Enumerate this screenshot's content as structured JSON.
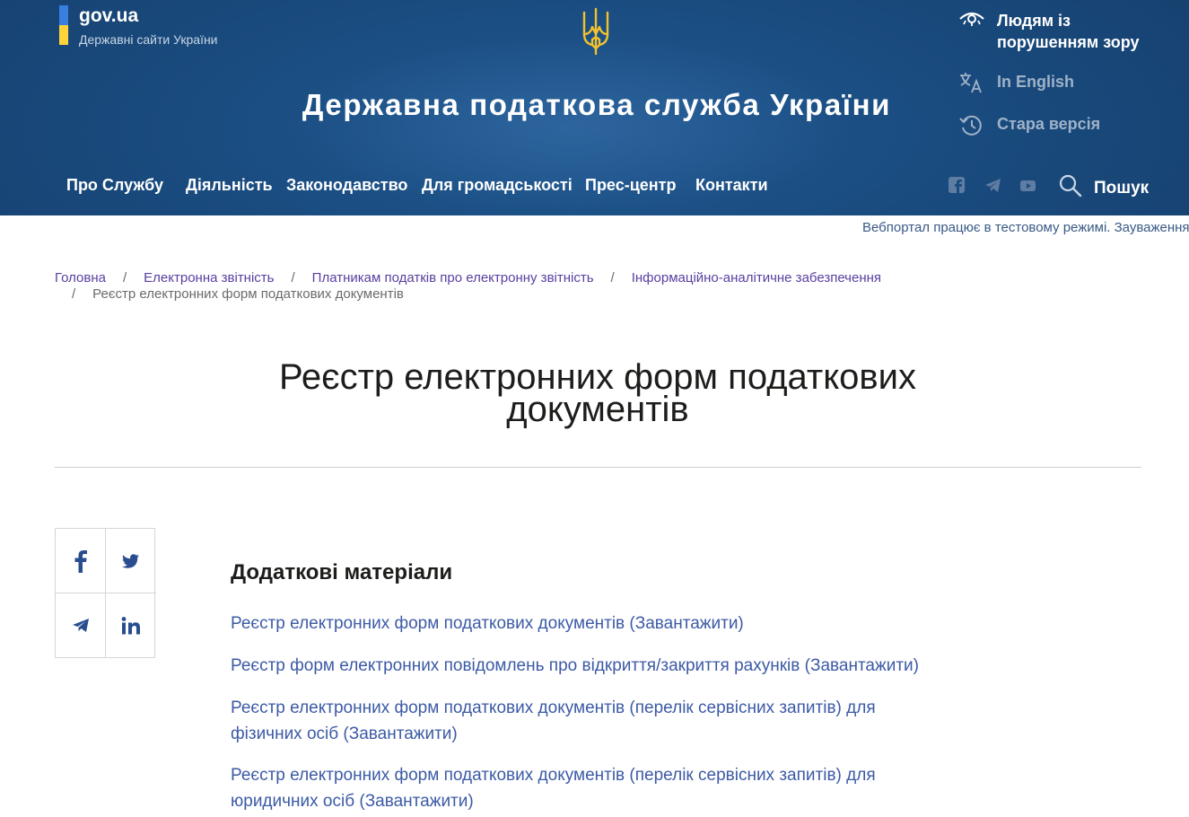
{
  "colors": {
    "header_bg": "#1a4c80",
    "flag_blue": "#3a7ee0",
    "flag_yellow": "#ffd43a",
    "trident": "#f2c12e",
    "link_blue": "#3c5aa5",
    "breadcrumb_link": "#5a3fa0"
  },
  "govua": {
    "name": "gov.ua",
    "subtitle": "Державні сайти України"
  },
  "site_title": "Державна податкова служба України",
  "utility": {
    "vision": "Людям із порушенням зору",
    "english": "In English",
    "old_version": "Стара версія"
  },
  "nav": [
    {
      "label": "Про Службу"
    },
    {
      "label": "Діяльність"
    },
    {
      "label": "Законодавство"
    },
    {
      "label": "Для громадськості"
    },
    {
      "label": "Прес-центр"
    },
    {
      "label": "Контакти"
    }
  ],
  "social_top": [
    "facebook-icon",
    "telegram-icon",
    "youtube-icon"
  ],
  "search_label": "Пошук",
  "ticker": "Вебпортал працює в тестовому режимі. Зауваження",
  "breadcrumb": {
    "items": [
      "Головна",
      "Електронна звітність",
      "Платникам податків про електронну звітність",
      "Інформаційно-аналітичне забезпечення"
    ],
    "current": "Реєстр електронних форм податкових документів",
    "separator": "/"
  },
  "page_title_line1": "Реєстр електронних форм податкових",
  "page_title_line2": "документів",
  "share_icons": [
    "facebook-icon",
    "twitter-icon",
    "telegram-icon",
    "linkedin-icon"
  ],
  "materials": {
    "title": "Додаткові матеріали",
    "links": [
      "Реєстр електронних форм податкових документів (Завантажити)",
      "Реєстр форм електронних повідомлень про відкриття/закриття рахунків (Завантажити)",
      "Реєстр електронних форм податкових документів (перелік сервісних запитів) для фізичних осіб (Завантажити)",
      "Реєстр електронних форм податкових документів (перелік сервісних запитів) для юридичних осіб (Завантажити)"
    ]
  }
}
